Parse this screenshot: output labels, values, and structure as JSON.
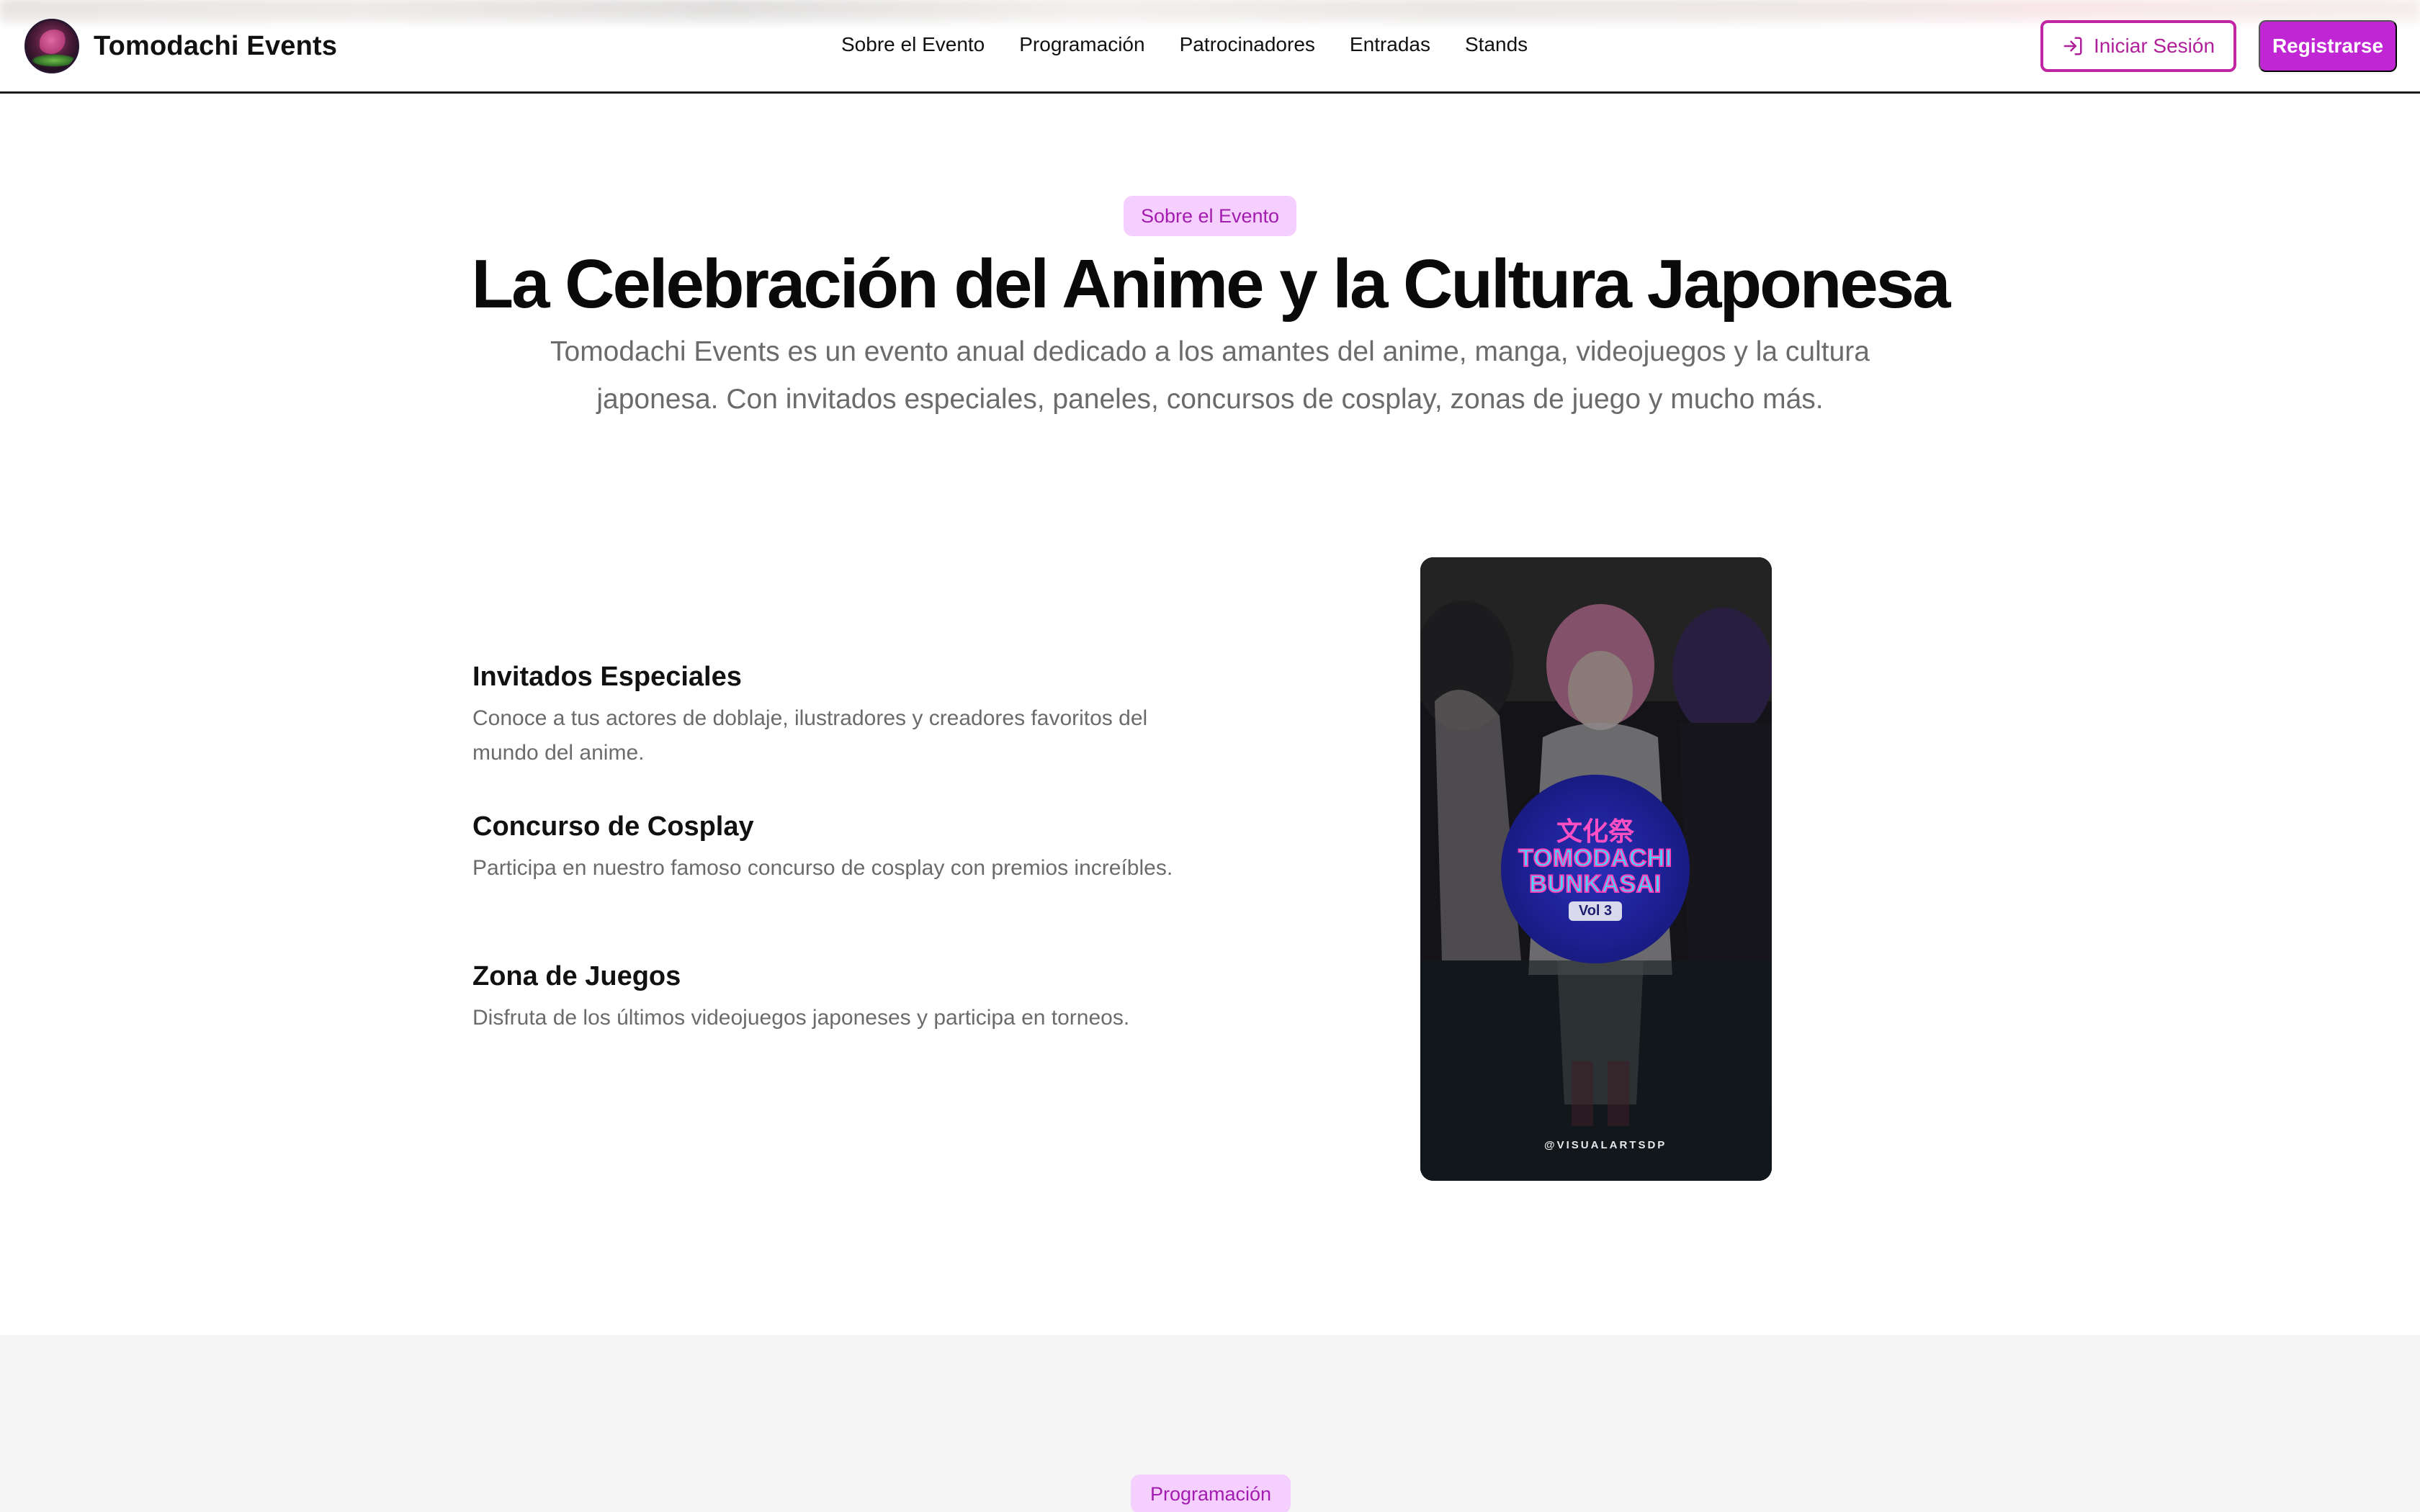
{
  "brand": {
    "name": "Tomodachi Events",
    "logo_icon": "brand-avatar-icon"
  },
  "nav": {
    "links": [
      "Sobre el Evento",
      "Programación",
      "Patrocinadores",
      "Entradas",
      "Stands"
    ],
    "login_label": "Iniciar Sesión",
    "login_icon": "login-arrow-icon",
    "register_label": "Registrarse"
  },
  "about": {
    "badge": "Sobre el Evento",
    "headline": "La Celebración del Anime y la Cultura Japonesa",
    "lead": "Tomodachi Events es un evento anual dedicado a los amantes del anime, manga, videojuegos y la cultura japonesa. Con invitados especiales, paneles, concursos de cosplay, zonas de juego y mucho más.",
    "features": [
      {
        "title": "Invitados Especiales",
        "desc": "Conoce a tus actores de doblaje, ilustradores y creadores favoritos del mundo del anime."
      },
      {
        "title": "Concurso de Cosplay",
        "desc": "Participa en nuestro famoso concurso de cosplay con premios increíbles."
      },
      {
        "title": "Zona de Juegos",
        "desc": "Disfruta de los últimos videojuegos japoneses y participa en torneos."
      }
    ],
    "video": {
      "logo_top": "文化祭",
      "logo_line1": "TOMODACHI",
      "logo_line2": "BUNKASAI",
      "logo_vol": "Vol 3",
      "credit": "@VISUALARTSDP"
    }
  },
  "schedule": {
    "badge": "Programación"
  },
  "colors": {
    "accent": "#c026d3",
    "badge_bg": "#f5d0fe",
    "badge_text": "#a21caf",
    "muted_text": "#6b6b6b",
    "section_bg": "#f5f5f5"
  }
}
